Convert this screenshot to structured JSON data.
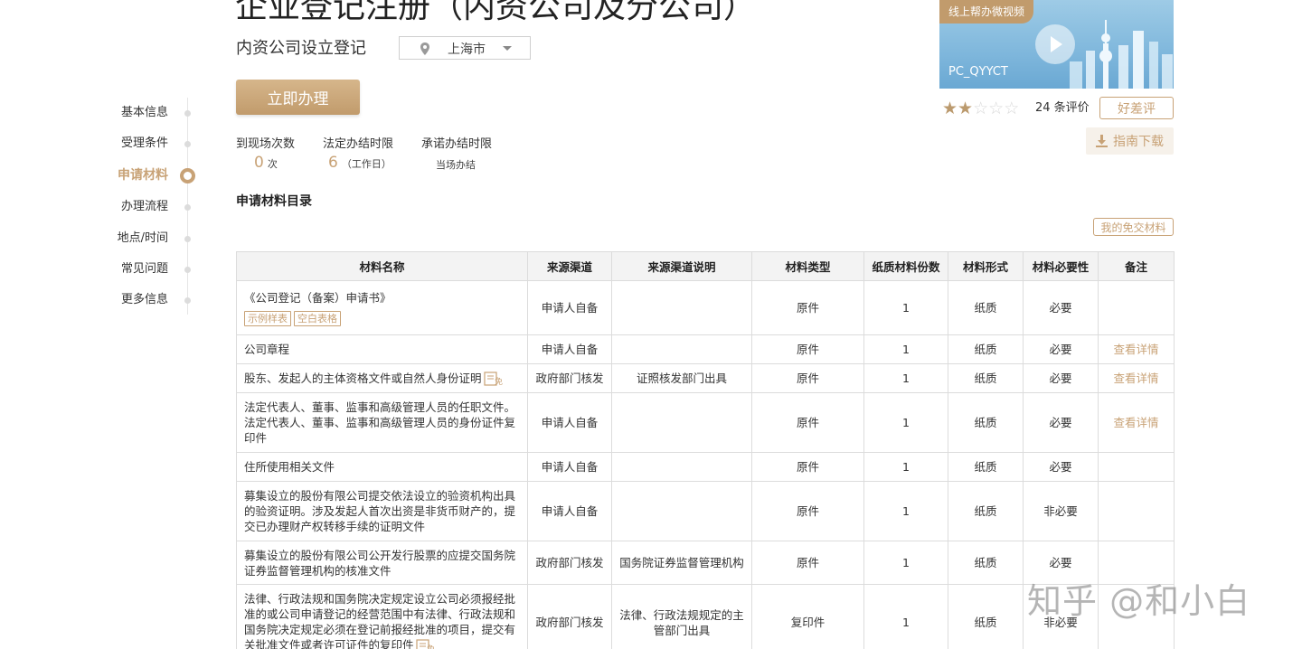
{
  "header": {
    "title": "企业登记注册（内资公司及分公司）",
    "subtitle": "内资公司设立登记",
    "region": "上海市",
    "apply_label": "立即办理"
  },
  "stats": [
    {
      "label": "到现场次数",
      "value": "0",
      "unit": "次"
    },
    {
      "label": "法定办结时限",
      "value": "6",
      "unit": "（工作日）"
    },
    {
      "label": "承诺办结时限",
      "note": "当场办结"
    }
  ],
  "side_nav": [
    {
      "label": "基本信息",
      "active": false
    },
    {
      "label": "受理条件",
      "active": false
    },
    {
      "label": "申请材料",
      "active": true
    },
    {
      "label": "办理流程",
      "active": false
    },
    {
      "label": "地点/时间",
      "active": false
    },
    {
      "label": "常见问题",
      "active": false
    },
    {
      "label": "更多信息",
      "active": false
    }
  ],
  "video": {
    "tag": "线上帮办微视频",
    "code": "PC_QYYCT"
  },
  "rating": {
    "stars": 2,
    "max_stars": 5,
    "count_text": "24 条评价",
    "review_label": "好差评",
    "guide_label": "指南下载"
  },
  "materials": {
    "section_title": "申请材料目录",
    "free_label": "我的免交材料",
    "headers": [
      "材料名称",
      "来源渠道",
      "来源渠道说明",
      "材料类型",
      "纸质材料份数",
      "材料形式",
      "材料必要性",
      "备注"
    ],
    "rows": [
      {
        "name": "《公司登记（备案）申请书》",
        "tags": [
          "示例样表",
          "空白表格"
        ],
        "source": "申请人自备",
        "source_desc": "",
        "type": "原件",
        "copies": "1",
        "form": "纸质",
        "necessity": "必要",
        "remark": ""
      },
      {
        "name": "公司章程",
        "tags": [],
        "source": "申请人自备",
        "source_desc": "",
        "type": "原件",
        "copies": "1",
        "form": "纸质",
        "necessity": "必要",
        "remark": "查看详情"
      },
      {
        "name": "股东、发起人的主体资格文件或自然人身份证明",
        "tags": [],
        "exempt": true,
        "source": "政府部门核发",
        "source_desc": "证照核发部门出具",
        "type": "原件",
        "copies": "1",
        "form": "纸质",
        "necessity": "必要",
        "remark": "查看详情"
      },
      {
        "name": "法定代表人、董事、监事和高级管理人员的任职文件。法定代表人、董事、监事和高级管理人员的身份证件复印件",
        "tags": [],
        "source": "申请人自备",
        "source_desc": "",
        "type": "原件",
        "copies": "1",
        "form": "纸质",
        "necessity": "必要",
        "remark": "查看详情"
      },
      {
        "name": "住所使用相关文件",
        "tags": [],
        "source": "申请人自备",
        "source_desc": "",
        "type": "原件",
        "copies": "1",
        "form": "纸质",
        "necessity": "必要",
        "remark": ""
      },
      {
        "name": "募集设立的股份有限公司提交依法设立的验资机构出具的验资证明。涉及发起人首次出资是非货币财产的，提交已办理财产权转移手续的证明文件",
        "tags": [],
        "source": "申请人自备",
        "source_desc": "",
        "type": "原件",
        "copies": "1",
        "form": "纸质",
        "necessity": "非必要",
        "remark": ""
      },
      {
        "name": "募集设立的股份有限公司公开发行股票的应提交国务院证券监督管理机构的核准文件",
        "tags": [],
        "source": "政府部门核发",
        "source_desc": "国务院证券监督管理机构",
        "type": "原件",
        "copies": "1",
        "form": "纸质",
        "necessity": "必要",
        "remark": ""
      },
      {
        "name": "法律、行政法规和国务院决定规定设立公司必须报经批准的或公司申请登记的经营范围中有法律、行政法规和国务院决定规定必须在登记前报经批准的项目，提交有关批准文件或者许可证件的复印件",
        "tags": [],
        "exempt": true,
        "source": "政府部门核发",
        "source_desc": "法律、行政法规规定的主管部门出具",
        "type": "复印件",
        "copies": "1",
        "form": "纸质",
        "necessity": "非必要",
        "remark": ""
      }
    ]
  },
  "watermark": "知乎 @和小白",
  "colors": {
    "accent": "#c8a276",
    "star_on": "#bb9a6e",
    "header_bg": "#f3f3f3"
  }
}
